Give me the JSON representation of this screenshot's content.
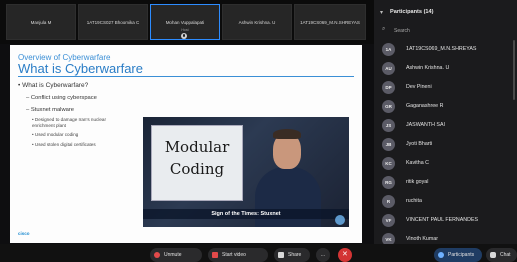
{
  "video_strip": {
    "tiles": [
      {
        "name": "Manjula M",
        "sub": ""
      },
      {
        "name": "1AT19CS027 Bhoomika C",
        "sub": ""
      },
      {
        "name": "Mohan Vuppalapati",
        "sub": "Host"
      },
      {
        "name": "Ashwin Krishna. U",
        "sub": ""
      },
      {
        "name": "1AT19CS069_M.N.SHREYAS",
        "sub": ""
      }
    ]
  },
  "slide": {
    "overview": "Overview of Cyberwarfare",
    "title": "What is Cyberwarfare",
    "bullets": {
      "b1": "What is Cyberwarfare?",
      "b2": "Conflict using cyberspace",
      "b3": "Stuxnet malware",
      "b4": "Designed to damage Iran's nuclear enrichment plant",
      "b5": "Used modular coding",
      "b6": "Used stolen digital certificates"
    },
    "video_board_line1": "Modular",
    "video_board_line2": "Coding",
    "video_caption": "Sign of the Times: Stuxnet",
    "logo": "cisco"
  },
  "participants_panel": {
    "title": "Participants (14)",
    "search_placeholder": "Search",
    "people": [
      {
        "initials": "1A",
        "name": "1AT19CS069_M.N.SHREYAS"
      },
      {
        "initials": "AU",
        "name": "Ashwin Krishna. U"
      },
      {
        "initials": "DP",
        "name": "Dev Pineni"
      },
      {
        "initials": "GR",
        "name": "Gaganashree R"
      },
      {
        "initials": "JS",
        "name": "JASWANTH SAI"
      },
      {
        "initials": "JB",
        "name": "Jyoti Bharti"
      },
      {
        "initials": "KC",
        "name": "Kavitha C"
      },
      {
        "initials": "RG",
        "name": "ritik goyal"
      },
      {
        "initials": "R",
        "name": "ruchita"
      },
      {
        "initials": "VF",
        "name": "VINCENT PAUL FERNANDES"
      },
      {
        "initials": "VK",
        "name": "Vinoth Kumar"
      }
    ]
  },
  "toolbar": {
    "unmute": "Unmute",
    "start_video": "Start video",
    "share": "Share",
    "more": "...",
    "participants": "Participants",
    "chat": "Chat"
  },
  "colors": {
    "accent": "#2d8cff",
    "leave": "#d33434",
    "muted": "#e34a4a"
  }
}
